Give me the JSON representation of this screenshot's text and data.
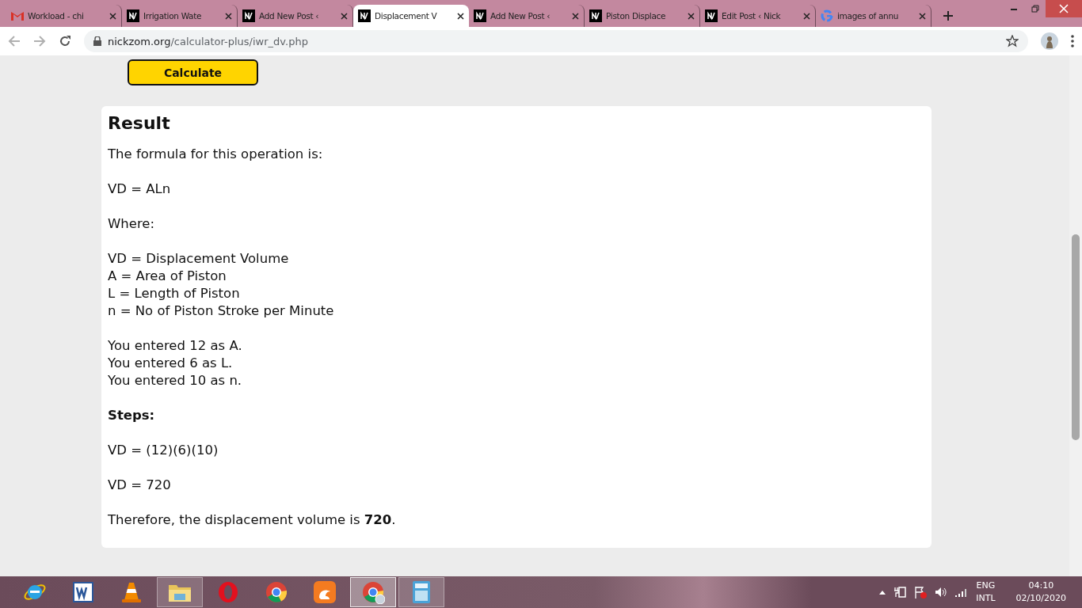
{
  "tabs": [
    {
      "title": "Workload - chi",
      "kind": "gmail",
      "selected": false
    },
    {
      "title": "Irrigation Wate",
      "kind": "site",
      "selected": false
    },
    {
      "title": "Add New Post ‹",
      "kind": "site",
      "selected": false
    },
    {
      "title": "Displacement V",
      "kind": "site",
      "selected": true
    },
    {
      "title": "Add New Post ‹",
      "kind": "site",
      "selected": false
    },
    {
      "title": "Piston Displace",
      "kind": "site",
      "selected": false
    },
    {
      "title": "Edit Post ‹ Nick",
      "kind": "site",
      "selected": false
    },
    {
      "title": "images of annu",
      "kind": "google",
      "selected": false
    }
  ],
  "address_bar": {
    "url_host": "nickzom.org",
    "url_path": "/calculator-plus/iwr_dv.php"
  },
  "calculate_button": "Calculate",
  "result": {
    "title": "Result",
    "paragraphs": [
      {
        "kind": "text",
        "lines": [
          "The formula for this operation is:"
        ]
      },
      {
        "kind": "text",
        "lines": [
          "VD = ALn"
        ]
      },
      {
        "kind": "text",
        "lines": [
          "Where:"
        ]
      },
      {
        "kind": "text",
        "lines": [
          "VD = Displacement Volume",
          "A = Area of Piston",
          "L = Length of Piston",
          "n = No of Piston Stroke per Minute"
        ]
      },
      {
        "kind": "text",
        "lines": [
          "You entered 12 as A.",
          "You entered 6 as L.",
          "You entered 10 as n."
        ]
      },
      {
        "kind": "heading",
        "lines": [
          "Steps:"
        ]
      },
      {
        "kind": "text",
        "lines": [
          "VD = (12)(6)(10)"
        ]
      },
      {
        "kind": "text",
        "lines": [
          "VD = 720"
        ]
      },
      {
        "kind": "text",
        "lines": [
          "Therefore, the displacement volume is **720**."
        ]
      }
    ]
  },
  "taskbar": {
    "apps": [
      {
        "kind": "ie",
        "running": false,
        "selected": false
      },
      {
        "kind": "word",
        "running": false,
        "selected": false
      },
      {
        "kind": "vlc",
        "running": false,
        "selected": false
      },
      {
        "kind": "explorer",
        "running": true,
        "selected": false
      },
      {
        "kind": "opera",
        "running": false,
        "selected": false
      },
      {
        "kind": "chrome",
        "running": false,
        "selected": false
      },
      {
        "kind": "uc",
        "running": false,
        "selected": false
      },
      {
        "kind": "chromeprofile",
        "running": true,
        "selected": true
      },
      {
        "kind": "calculator",
        "running": true,
        "selected": false
      }
    ],
    "language": [
      "ENG",
      "INTL"
    ],
    "time": "04:10",
    "date": "02/10/2020"
  }
}
